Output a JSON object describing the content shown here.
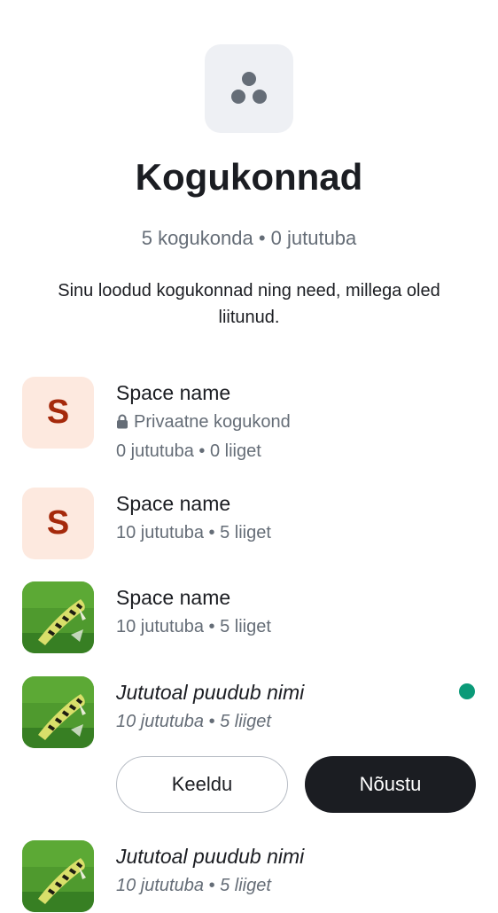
{
  "header": {
    "icon": "spaces-icon",
    "title": "Kogukonnad",
    "counts": "5 kogukonda • 0 jututuba",
    "description": "Sinu loodud kogukonnad ning need, millega oled liitunud."
  },
  "spaces": [
    {
      "avatar_letter": "S",
      "name": "Space name",
      "privacy_label": "Privaatne kogukond",
      "stats": "0 jututuba • 0 liiget"
    },
    {
      "avatar_letter": "S",
      "name": "Space name",
      "stats": "10 jututuba • 5 liiget"
    },
    {
      "avatar_image": "caterpillar-photo",
      "name": "Space name",
      "stats": "10 jututuba • 5 liiget"
    },
    {
      "avatar_image": "caterpillar-photo",
      "name": "Jututoal puudub nimi",
      "stats": "10 jututuba • 5 liiget",
      "unread_indicator": true,
      "decline_label": "Keeldu",
      "accept_label": "Nõustu"
    },
    {
      "avatar_image": "caterpillar-photo",
      "name": "Jututoal puudub nimi",
      "stats": "10 jututuba • 5 liiget"
    }
  ],
  "colors": {
    "accent": "#0a9a78",
    "letter_avatar_bg": "#fde9df",
    "letter_avatar_fg": "#a5290b",
    "primary_button": "#1b1d22"
  }
}
